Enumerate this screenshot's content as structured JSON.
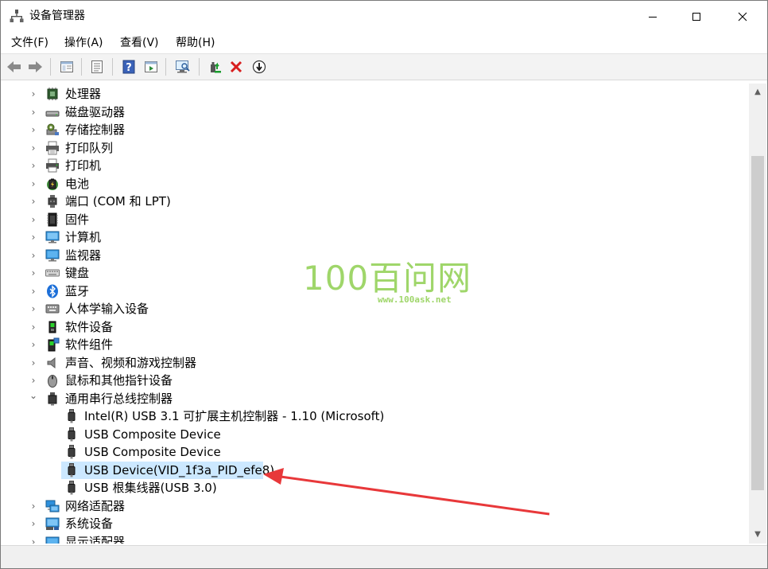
{
  "window": {
    "title": "设备管理器"
  },
  "menu": [
    "文件(F)",
    "操作(A)",
    "查看(V)",
    "帮助(H)"
  ],
  "toolbar": {
    "buttons": [
      "back-icon",
      "forward-icon",
      "properties-pane-icon",
      "view-list-icon",
      "help-icon",
      "action-pane-icon",
      "scan-hardware-icon",
      "update-driver-icon",
      "uninstall-icon",
      "disable-device-icon"
    ]
  },
  "tree": {
    "categories_top": [
      {
        "label": "处理器",
        "icon": "cpu-icon"
      },
      {
        "label": "磁盘驱动器",
        "icon": "disk-drive-icon"
      },
      {
        "label": "存储控制器",
        "icon": "storage-controller-icon"
      },
      {
        "label": "打印队列",
        "icon": "print-queue-icon"
      },
      {
        "label": "打印机",
        "icon": "printer-icon"
      },
      {
        "label": "电池",
        "icon": "battery-icon"
      },
      {
        "label": "端口 (COM 和 LPT)",
        "icon": "port-icon"
      },
      {
        "label": "固件",
        "icon": "firmware-icon"
      },
      {
        "label": "计算机",
        "icon": "computer-icon"
      },
      {
        "label": "监视器",
        "icon": "monitor-icon"
      },
      {
        "label": "键盘",
        "icon": "keyboard-icon"
      },
      {
        "label": "蓝牙",
        "icon": "bluetooth-icon"
      },
      {
        "label": "人体学输入设备",
        "icon": "hid-icon"
      },
      {
        "label": "软件设备",
        "icon": "software-device-icon"
      },
      {
        "label": "软件组件",
        "icon": "software-component-icon"
      },
      {
        "label": "声音、视频和游戏控制器",
        "icon": "sound-icon"
      },
      {
        "label": "鼠标和其他指针设备",
        "icon": "mouse-icon"
      }
    ],
    "usb_category": {
      "label": "通用串行总线控制器",
      "icon": "usb-controller-icon",
      "expanded": true
    },
    "usb_children": [
      {
        "label": "Intel(R) USB 3.1 可扩展主机控制器 - 1.10 (Microsoft)"
      },
      {
        "label": "USB Composite Device"
      },
      {
        "label": "USB Composite Device"
      },
      {
        "label": "USB Device(VID_1f3a_PID_efe8)",
        "selected": true
      },
      {
        "label": "USB 根集线器(USB 3.0)"
      }
    ],
    "categories_bottom": [
      {
        "label": "网络适配器",
        "icon": "network-adapter-icon"
      },
      {
        "label": "系统设备",
        "icon": "system-device-icon"
      },
      {
        "label": "显示适配器",
        "icon": "display-adapter-icon"
      }
    ]
  },
  "watermark": {
    "big": "100百问网",
    "small": "www.100ask.net"
  },
  "colors": {
    "selection": "#cce8ff",
    "arrow": "#e8383a",
    "watermark": "#9fd66a"
  }
}
